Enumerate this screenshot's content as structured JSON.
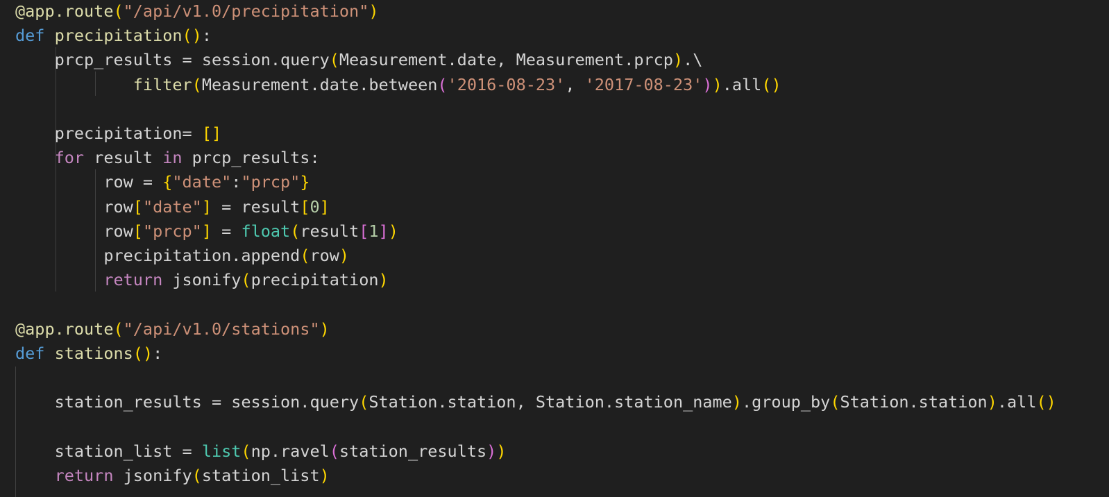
{
  "colors": {
    "background": "#1f1f1f",
    "default": "#d4d4d4",
    "keyword": "#569cd6",
    "control": "#c586c0",
    "function": "#dcdcaa",
    "string": "#ce9178",
    "number": "#b5cea8",
    "builtin": "#4ec9b0",
    "bracket_level1": "#ffd700",
    "bracket_level2": "#da70d6",
    "bracket_level3": "#179fff",
    "indent_guide": "#404040"
  },
  "editor": {
    "language": "python",
    "lines": [
      {
        "tokens": [
          {
            "t": "@app.route",
            "k": "function"
          },
          {
            "t": "(",
            "k": "bracket_level1"
          },
          {
            "t": "\"/api/v1.0/precipitation\"",
            "k": "string"
          },
          {
            "t": ")",
            "k": "bracket_level1"
          }
        ]
      },
      {
        "tokens": [
          {
            "t": "def",
            "k": "keyword"
          },
          {
            "t": " ",
            "k": "default"
          },
          {
            "t": "precipitation",
            "k": "function"
          },
          {
            "t": "()",
            "k": "bracket_level1"
          },
          {
            "t": ":",
            "k": "default"
          }
        ]
      },
      {
        "tokens": [
          {
            "t": "    prcp_results = session.query",
            "k": "default"
          },
          {
            "t": "(",
            "k": "bracket_level1"
          },
          {
            "t": "Measurement.date, Measurement.prcp",
            "k": "default"
          },
          {
            "t": ")",
            "k": "bracket_level1"
          },
          {
            "t": ".\\",
            "k": "default"
          }
        ]
      },
      {
        "tokens": [
          {
            "t": "            filter",
            "k": "function"
          },
          {
            "t": "(",
            "k": "bracket_level1"
          },
          {
            "t": "Measurement.date.between",
            "k": "default"
          },
          {
            "t": "(",
            "k": "bracket_level2"
          },
          {
            "t": "'2016-08-23'",
            "k": "string"
          },
          {
            "t": ", ",
            "k": "default"
          },
          {
            "t": "'2017-08-23'",
            "k": "string"
          },
          {
            "t": ")",
            "k": "bracket_level2"
          },
          {
            "t": ")",
            "k": "bracket_level1"
          },
          {
            "t": ".all",
            "k": "default"
          },
          {
            "t": "()",
            "k": "bracket_level1"
          }
        ]
      },
      {
        "tokens": []
      },
      {
        "tokens": [
          {
            "t": "    precipitation= ",
            "k": "default"
          },
          {
            "t": "[]",
            "k": "bracket_level1"
          }
        ]
      },
      {
        "tokens": [
          {
            "t": "    ",
            "k": "default"
          },
          {
            "t": "for",
            "k": "control"
          },
          {
            "t": " result ",
            "k": "default"
          },
          {
            "t": "in",
            "k": "control"
          },
          {
            "t": " prcp_results:",
            "k": "default"
          }
        ]
      },
      {
        "tokens": [
          {
            "t": "         row = ",
            "k": "default"
          },
          {
            "t": "{",
            "k": "bracket_level1"
          },
          {
            "t": "\"date\"",
            "k": "string"
          },
          {
            "t": ":",
            "k": "default"
          },
          {
            "t": "\"prcp\"",
            "k": "string"
          },
          {
            "t": "}",
            "k": "bracket_level1"
          }
        ]
      },
      {
        "tokens": [
          {
            "t": "         row",
            "k": "default"
          },
          {
            "t": "[",
            "k": "bracket_level1"
          },
          {
            "t": "\"date\"",
            "k": "string"
          },
          {
            "t": "]",
            "k": "bracket_level1"
          },
          {
            "t": " = result",
            "k": "default"
          },
          {
            "t": "[",
            "k": "bracket_level1"
          },
          {
            "t": "0",
            "k": "number"
          },
          {
            "t": "]",
            "k": "bracket_level1"
          }
        ]
      },
      {
        "tokens": [
          {
            "t": "         row",
            "k": "default"
          },
          {
            "t": "[",
            "k": "bracket_level1"
          },
          {
            "t": "\"prcp\"",
            "k": "string"
          },
          {
            "t": "]",
            "k": "bracket_level1"
          },
          {
            "t": " = ",
            "k": "default"
          },
          {
            "t": "float",
            "k": "builtin"
          },
          {
            "t": "(",
            "k": "bracket_level1"
          },
          {
            "t": "result",
            "k": "default"
          },
          {
            "t": "[",
            "k": "bracket_level2"
          },
          {
            "t": "1",
            "k": "number"
          },
          {
            "t": "]",
            "k": "bracket_level2"
          },
          {
            "t": ")",
            "k": "bracket_level1"
          }
        ]
      },
      {
        "tokens": [
          {
            "t": "         precipitation.append",
            "k": "default"
          },
          {
            "t": "(",
            "k": "bracket_level1"
          },
          {
            "t": "row",
            "k": "default"
          },
          {
            "t": ")",
            "k": "bracket_level1"
          }
        ]
      },
      {
        "tokens": [
          {
            "t": "         ",
            "k": "default"
          },
          {
            "t": "return",
            "k": "control"
          },
          {
            "t": " jsonify",
            "k": "default"
          },
          {
            "t": "(",
            "k": "bracket_level1"
          },
          {
            "t": "precipitation",
            "k": "default"
          },
          {
            "t": ")",
            "k": "bracket_level1"
          }
        ]
      },
      {
        "tokens": []
      },
      {
        "tokens": [
          {
            "t": "@app.route",
            "k": "function"
          },
          {
            "t": "(",
            "k": "bracket_level1"
          },
          {
            "t": "\"/api/v1.0/stations\"",
            "k": "string"
          },
          {
            "t": ")",
            "k": "bracket_level1"
          }
        ]
      },
      {
        "tokens": [
          {
            "t": "def",
            "k": "keyword"
          },
          {
            "t": " ",
            "k": "default"
          },
          {
            "t": "stations",
            "k": "function"
          },
          {
            "t": "()",
            "k": "bracket_level1"
          },
          {
            "t": ":",
            "k": "default"
          }
        ]
      },
      {
        "tokens": []
      },
      {
        "tokens": [
          {
            "t": "    station_results = session.query",
            "k": "default"
          },
          {
            "t": "(",
            "k": "bracket_level1"
          },
          {
            "t": "Station.station, Station.station_name",
            "k": "default"
          },
          {
            "t": ")",
            "k": "bracket_level1"
          },
          {
            "t": ".group_by",
            "k": "default"
          },
          {
            "t": "(",
            "k": "bracket_level1"
          },
          {
            "t": "Station.station",
            "k": "default"
          },
          {
            "t": ")",
            "k": "bracket_level1"
          },
          {
            "t": ".all",
            "k": "default"
          },
          {
            "t": "()",
            "k": "bracket_level1"
          }
        ]
      },
      {
        "tokens": []
      },
      {
        "tokens": [
          {
            "t": "    station_list = ",
            "k": "default"
          },
          {
            "t": "list",
            "k": "builtin"
          },
          {
            "t": "(",
            "k": "bracket_level1"
          },
          {
            "t": "np.ravel",
            "k": "default"
          },
          {
            "t": "(",
            "k": "bracket_level2"
          },
          {
            "t": "station_results",
            "k": "default"
          },
          {
            "t": ")",
            "k": "bracket_level2"
          },
          {
            "t": ")",
            "k": "bracket_level1"
          }
        ]
      },
      {
        "tokens": [
          {
            "t": "    ",
            "k": "default"
          },
          {
            "t": "return",
            "k": "control"
          },
          {
            "t": " jsonify",
            "k": "default"
          },
          {
            "t": "(",
            "k": "bracket_level1"
          },
          {
            "t": "station_list",
            "k": "default"
          },
          {
            "t": ")",
            "k": "bracket_level1"
          }
        ]
      }
    ]
  }
}
